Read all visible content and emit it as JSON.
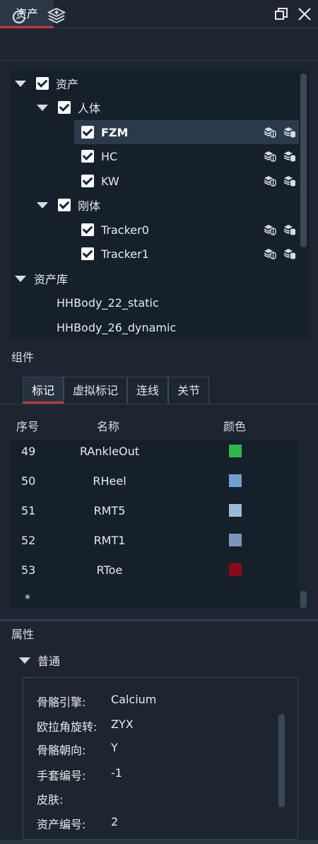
{
  "window": {
    "tab_label": "资产",
    "restore_icon": "restore-window-icon",
    "close_icon": "close-icon"
  },
  "toolbar": {
    "refresh_icon": "refresh-icon",
    "layers_icon": "add-layers-icon"
  },
  "tree": {
    "root_label": "资产",
    "humans_label": "人体",
    "humans": [
      {
        "label": "FZM",
        "selected": true
      },
      {
        "label": "HC",
        "selected": false
      },
      {
        "label": "KW",
        "selected": false
      }
    ],
    "rigid_label": "刚体",
    "rigid": [
      {
        "label": "Tracker0"
      },
      {
        "label": "Tracker1"
      }
    ],
    "library_label": "资产库",
    "library": [
      {
        "label": "HHBody_22_static"
      },
      {
        "label": "HHBody_26_dynamic"
      }
    ]
  },
  "components": {
    "label": "组件",
    "tabs": [
      {
        "label": "标记",
        "active": true
      },
      {
        "label": "虚拟标记",
        "active": false
      },
      {
        "label": "连线",
        "active": false
      },
      {
        "label": "关节",
        "active": false
      }
    ],
    "columns": {
      "index": "序号",
      "name": "名称",
      "color": "颜色"
    },
    "markers": [
      {
        "index": "49",
        "name": "RAnkleOut",
        "color": "#2fb84a"
      },
      {
        "index": "50",
        "name": "RHeel",
        "color": "#6f9fce"
      },
      {
        "index": "51",
        "name": "RMT5",
        "color": "#9cbbd8"
      },
      {
        "index": "52",
        "name": "RMT1",
        "color": "#7a96ba"
      },
      {
        "index": "53",
        "name": "RToe",
        "color": "#8c0a18"
      }
    ],
    "new_row_marker": "*"
  },
  "properties": {
    "label": "属性",
    "section_label": "普通",
    "rows": [
      {
        "key": "骨骼引擎:",
        "value": "Calcium"
      },
      {
        "key": "欧拉角旋转:",
        "value": "ZYX"
      },
      {
        "key": "骨骼朝向:",
        "value": "Y"
      },
      {
        "key": "手套编号:",
        "value": "-1"
      },
      {
        "key": "皮肤:",
        "value": ""
      },
      {
        "key": "资产编号:",
        "value": "2"
      }
    ]
  },
  "colors": {
    "accent": "#c8363a",
    "background": "#1d2630",
    "panel": "#16202b"
  }
}
